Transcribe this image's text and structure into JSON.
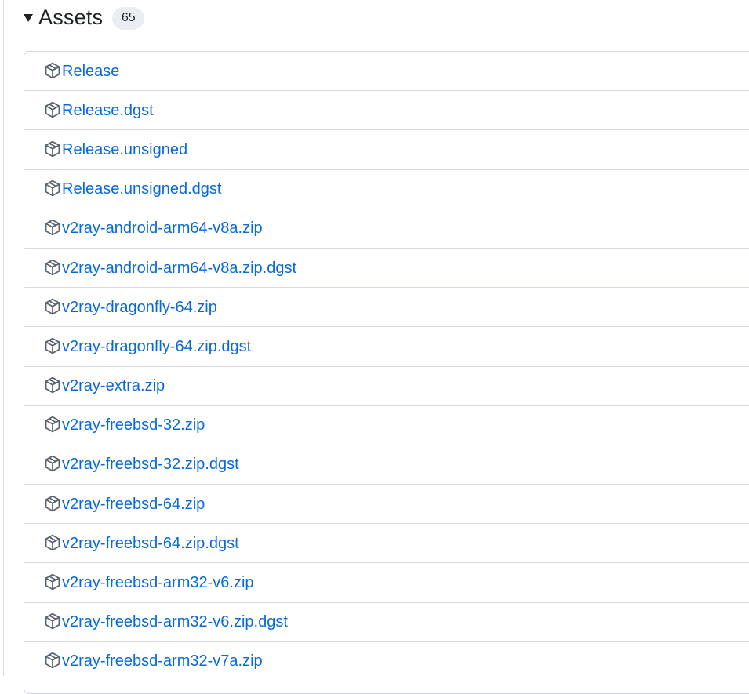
{
  "assets": {
    "title": "Assets",
    "count": "65",
    "icon": "package-icon",
    "colors": {
      "link": "#0969da",
      "text": "#1f2328",
      "border": "#d0d7de",
      "badge_bg": "#eaeef2"
    },
    "items": [
      {
        "name": "Release"
      },
      {
        "name": "Release.dgst"
      },
      {
        "name": "Release.unsigned"
      },
      {
        "name": "Release.unsigned.dgst"
      },
      {
        "name": "v2ray-android-arm64-v8a.zip"
      },
      {
        "name": "v2ray-android-arm64-v8a.zip.dgst"
      },
      {
        "name": "v2ray-dragonfly-64.zip"
      },
      {
        "name": "v2ray-dragonfly-64.zip.dgst"
      },
      {
        "name": "v2ray-extra.zip"
      },
      {
        "name": "v2ray-freebsd-32.zip"
      },
      {
        "name": "v2ray-freebsd-32.zip.dgst"
      },
      {
        "name": "v2ray-freebsd-64.zip"
      },
      {
        "name": "v2ray-freebsd-64.zip.dgst"
      },
      {
        "name": "v2ray-freebsd-arm32-v6.zip"
      },
      {
        "name": "v2ray-freebsd-arm32-v6.zip.dgst"
      },
      {
        "name": "v2ray-freebsd-arm32-v7a.zip"
      }
    ]
  }
}
